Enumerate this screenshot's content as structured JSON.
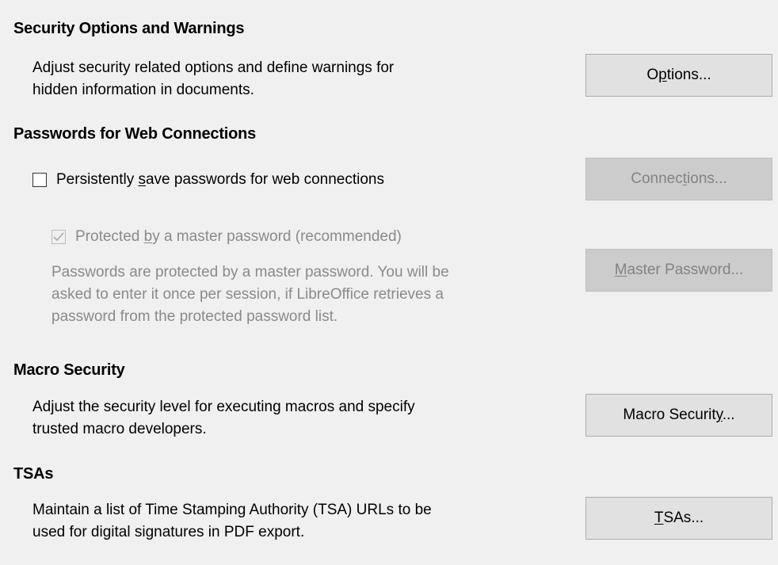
{
  "security_options": {
    "heading": "Security Options and Warnings",
    "description": "Adjust security related options and define warnings for\nhidden information in documents.",
    "button": {
      "pre": "O",
      "mnemonic": "p",
      "post": "tions..."
    }
  },
  "web_passwords": {
    "heading": "Passwords for Web Connections",
    "persist_checkbox": {
      "pre": "Persistently ",
      "mnemonic": "s",
      "post": "ave passwords for web connections",
      "checked": false
    },
    "connections_button": {
      "pre": "Connec",
      "mnemonic": "t",
      "post": "ions...",
      "enabled": false
    },
    "master_checkbox": {
      "pre": "Protected ",
      "mnemonic": "b",
      "post": "y a master password (recommended)",
      "checked": true,
      "enabled": false
    },
    "master_description": "Passwords are protected by a master password. You will be\nasked to enter it once per session, if LibreOffice retrieves a\npassword from the protected password list.",
    "master_button": {
      "pre": "",
      "mnemonic": "M",
      "post": "aster Password...",
      "enabled": false
    }
  },
  "macro_security": {
    "heading": "Macro Security",
    "description": "Adjust the security level for executing macros and specify\ntrusted macro developers.",
    "button": {
      "pre": "Macro Securit",
      "mnemonic": "y",
      "post": "..."
    }
  },
  "tsas": {
    "heading": "TSAs",
    "description": "Maintain a list of Time Stamping Authority (TSA) URLs to be\nused for digital signatures in PDF export.",
    "button": {
      "pre": "",
      "mnemonic": "T",
      "post": "SAs..."
    }
  }
}
